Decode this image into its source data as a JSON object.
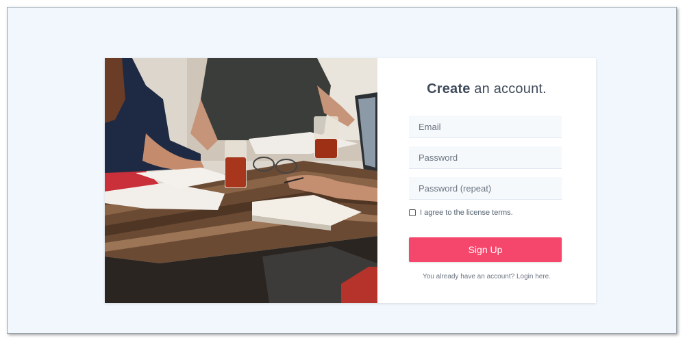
{
  "form": {
    "title_bold": "Create",
    "title_rest": " an account.",
    "email_placeholder": "Email",
    "password_placeholder": "Password",
    "password_repeat_placeholder": "Password (repeat)",
    "agree_label": "I agree to the license terms.",
    "agree_checked": false,
    "signup_label": "Sign Up",
    "login_prompt": "You already have an account? ",
    "login_link": "Login here."
  },
  "colors": {
    "accent": "#f4476b",
    "background": "#f1f7fc",
    "field_bg": "#f6f9fc",
    "text": "#505e6c"
  },
  "image": {
    "subject": "people-working-at-wooden-table"
  }
}
